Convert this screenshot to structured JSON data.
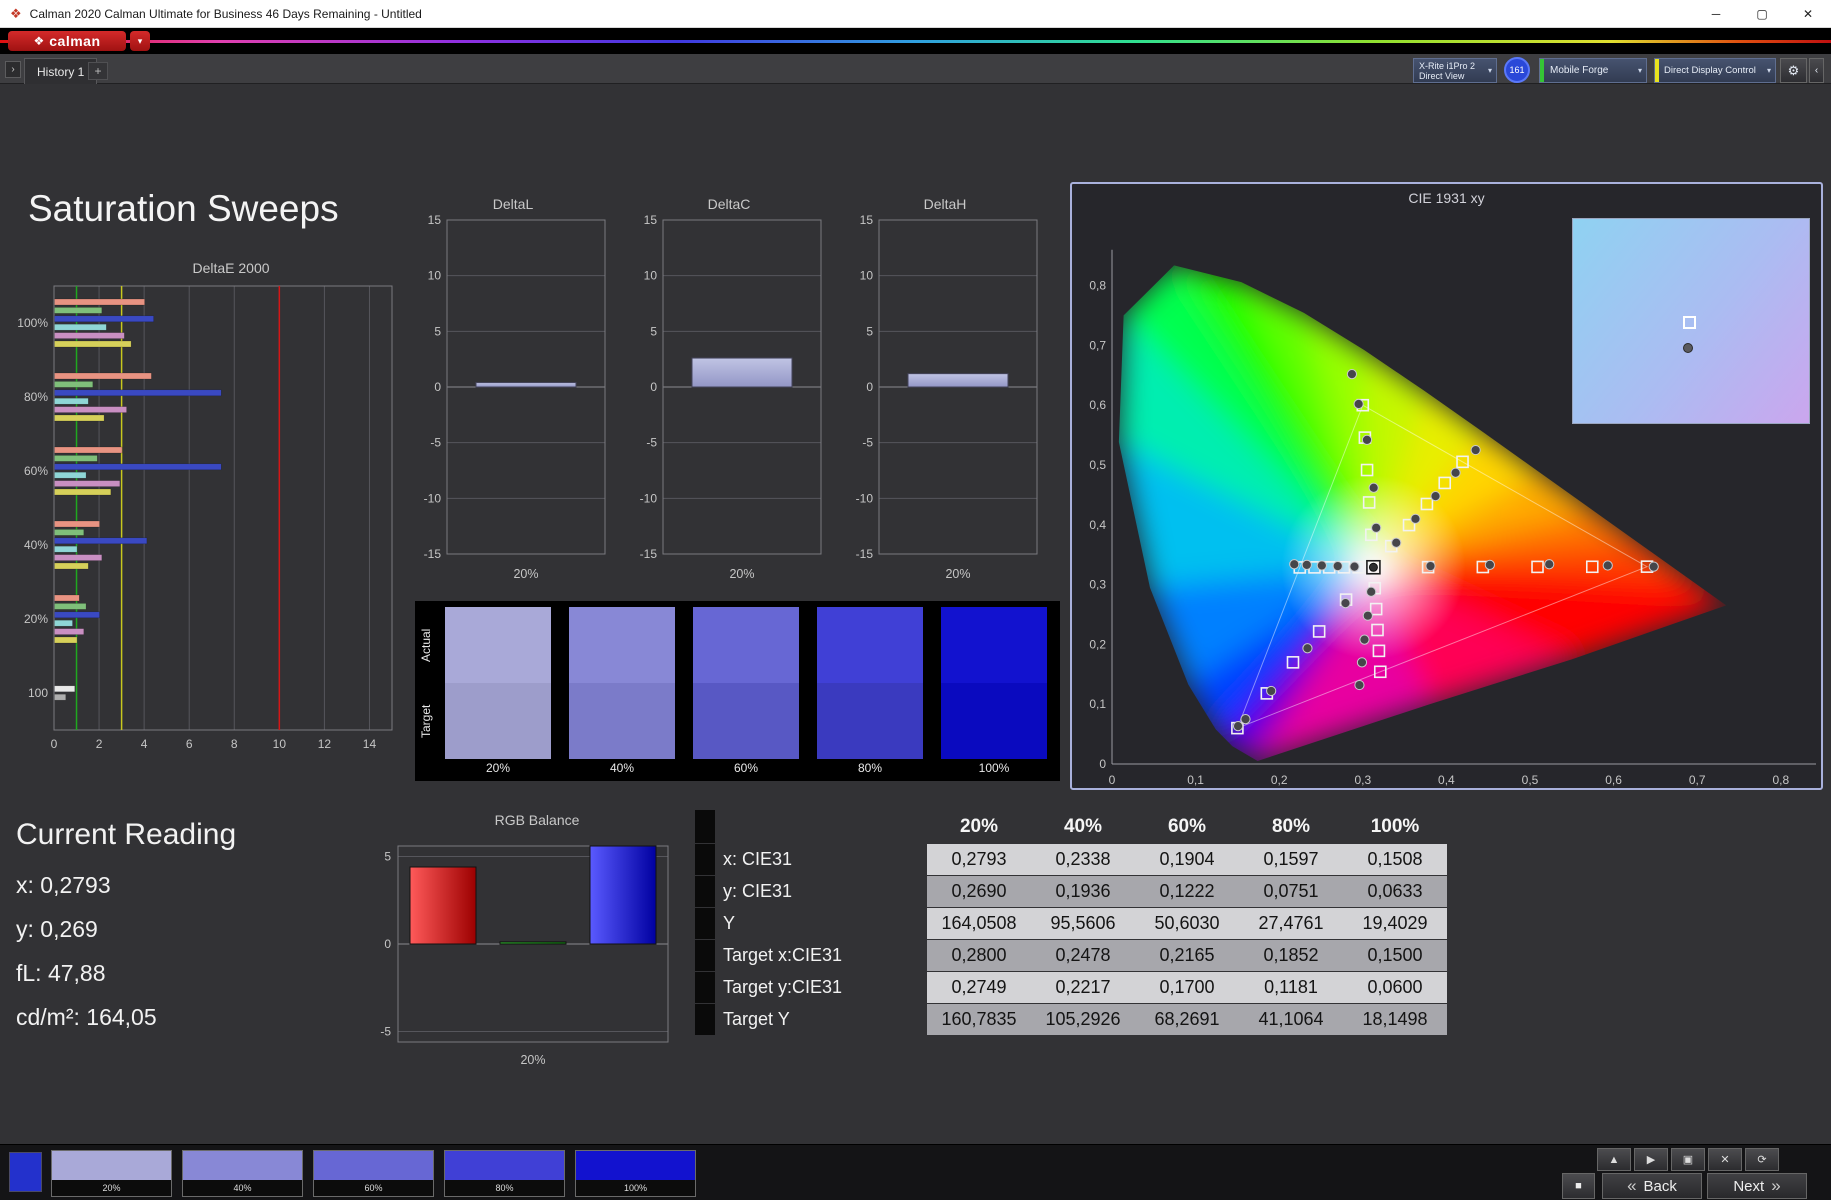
{
  "window": {
    "title": "Calman 2020 Calman Ultimate for Business 46 Days Remaining - Untitled"
  },
  "icons": {
    "app": "❖",
    "logo_mark": "❖",
    "dropdown": "▾",
    "gear": "⚙",
    "collapse": "‹",
    "panel_arrow": "›",
    "minimize": "─",
    "maximize": "▢",
    "close": "✕",
    "stop": "■",
    "back_chevrons": "«",
    "next_chevrons": "»"
  },
  "brand": {
    "logo_text": "calman"
  },
  "tabbar": {
    "history_tab": "History 1",
    "add_tab": "+",
    "meter_line1": "X-Rite i1Pro 2",
    "meter_line2": "Direct View",
    "badge": "161",
    "source_label": "Mobile Forge",
    "display_label": "Direct Display Control"
  },
  "toolbar_colors": {
    "source_stripe": "#35c435",
    "display_stripe": "#e8e21e"
  },
  "page": {
    "title": "Saturation Sweeps"
  },
  "current_reading": {
    "title": "Current Reading",
    "lines": [
      "x: 0,2793",
      "y: 0,269",
      "fL: 47,88",
      "cd/m²: 164,05"
    ]
  },
  "chart_data": {
    "deltae2000": {
      "type": "bar",
      "title": "DeltaE 2000",
      "orientation": "horizontal",
      "xlim": [
        0,
        15
      ],
      "xticks": [
        0,
        2,
        4,
        6,
        8,
        10,
        12,
        14
      ],
      "limit_lines": [
        {
          "value": 1,
          "color": "#1fa81f"
        },
        {
          "value": 3,
          "color": "#c8c81e"
        },
        {
          "value": 10,
          "color": "#d41616"
        }
      ],
      "groups": [
        {
          "label": "100%",
          "values": [
            4.0,
            2.1,
            4.4,
            2.3,
            3.1,
            3.4
          ],
          "colors": [
            "#e89382",
            "#7fbf7a",
            "#3a49c2",
            "#8fd6d6",
            "#c98fc2",
            "#d6d05a"
          ]
        },
        {
          "label": "80%",
          "values": [
            4.3,
            1.7,
            7.4,
            1.5,
            3.2,
            2.2
          ],
          "colors": [
            "#e89382",
            "#7fbf7a",
            "#3a49c2",
            "#8fd6d6",
            "#c98fc2",
            "#d6d05a"
          ]
        },
        {
          "label": "60%",
          "values": [
            3.0,
            1.9,
            7.4,
            1.4,
            2.9,
            2.5
          ],
          "colors": [
            "#e89382",
            "#7fbf7a",
            "#3a49c2",
            "#8fd6d6",
            "#c98fc2",
            "#d6d05a"
          ]
        },
        {
          "label": "40%",
          "values": [
            2.0,
            1.3,
            4.1,
            1.0,
            2.1,
            1.5
          ],
          "colors": [
            "#e89382",
            "#7fbf7a",
            "#3a49c2",
            "#8fd6d6",
            "#c98fc2",
            "#d6d05a"
          ]
        },
        {
          "label": "20%",
          "values": [
            1.1,
            1.4,
            2.0,
            0.8,
            1.3,
            1.0
          ],
          "colors": [
            "#e89382",
            "#7fbf7a",
            "#3a49c2",
            "#8fd6d6",
            "#c98fc2",
            "#d6d05a"
          ]
        },
        {
          "label": "100",
          "values": [
            0.9,
            0.5
          ],
          "colors": [
            "#e8e8e8",
            "#aeaeae"
          ]
        }
      ]
    },
    "deltaL": {
      "type": "bar",
      "title": "DeltaL",
      "value": 0.4,
      "ymax": 15,
      "yticks": [
        15,
        10,
        5,
        0,
        -5,
        -10,
        -15
      ],
      "xlabel": "20%"
    },
    "deltaC": {
      "type": "bar",
      "title": "DeltaC",
      "value": 2.6,
      "ymax": 15,
      "yticks": [
        15,
        10,
        5,
        0,
        -5,
        -10,
        -15
      ],
      "xlabel": "20%"
    },
    "deltaH": {
      "type": "bar",
      "title": "DeltaH",
      "value": 1.2,
      "ymax": 15,
      "yticks": [
        15,
        10,
        5,
        0,
        -5,
        -10,
        -15
      ],
      "xlabel": "20%"
    },
    "rgb_balance": {
      "type": "bar",
      "title": "RGB Balance",
      "ymax": 5.6,
      "yticks": [
        5,
        0,
        -5
      ],
      "xlabel": "20%",
      "series": [
        {
          "name": "red",
          "value": 4.4,
          "color_light": "#ff5a5a",
          "color_dark": "#9c0000"
        },
        {
          "name": "green",
          "value": 0.12,
          "color_light": "#2fae2f",
          "color_dark": "#0f7a0f"
        },
        {
          "name": "blue",
          "value": 5.9,
          "color_light": "#5a5aff",
          "color_dark": "#0000a0"
        }
      ]
    },
    "cie1931": {
      "type": "scatter",
      "title": "CIE 1931 xy",
      "xticks": [
        "0",
        "0,1",
        "0,2",
        "0,3",
        "0,4",
        "0,5",
        "0,6",
        "0,7",
        "0,8"
      ],
      "yticks": [
        "0",
        "0,1",
        "0,2",
        "0,3",
        "0,4",
        "0,5",
        "0,6",
        "0,7",
        "0,8"
      ],
      "white_point": [
        0.3127,
        0.329
      ],
      "gamut_triangle": [
        [
          0.64,
          0.33
        ],
        [
          0.3,
          0.6
        ],
        [
          0.15,
          0.06
        ]
      ],
      "locus": [
        [
          0.1741,
          0.005,
          "#7a00c8"
        ],
        [
          0.144,
          0.0297,
          "#3300ff"
        ],
        [
          0.1241,
          0.0578,
          "#0040ff"
        ],
        [
          0.0913,
          0.1327,
          "#0080ff"
        ],
        [
          0.0454,
          0.295,
          "#00c0f0"
        ],
        [
          0.0082,
          0.5384,
          "#00eeb0"
        ],
        [
          0.0139,
          0.7502,
          "#00ff50"
        ],
        [
          0.0743,
          0.8338,
          "#20ff00"
        ],
        [
          0.1547,
          0.8059,
          "#60ff00"
        ],
        [
          0.2296,
          0.7543,
          "#98ff00"
        ],
        [
          0.3016,
          0.6923,
          "#c4f800"
        ],
        [
          0.3731,
          0.6245,
          "#e8ee00"
        ],
        [
          0.4441,
          0.5547,
          "#ffd500"
        ],
        [
          0.5125,
          0.4866,
          "#ffaa00"
        ],
        [
          0.5752,
          0.4242,
          "#ff7700"
        ],
        [
          0.627,
          0.3725,
          "#ff4400"
        ],
        [
          0.6915,
          0.3083,
          "#ff1100"
        ],
        [
          0.7347,
          0.2653,
          "#ff0000"
        ],
        [
          0.55,
          0.175,
          "#ff0055"
        ],
        [
          0.38,
          0.1,
          "#e800a0"
        ]
      ],
      "targets": [
        [
          0.28,
          0.2749
        ],
        [
          0.2478,
          0.2217
        ],
        [
          0.2165,
          0.17
        ],
        [
          0.1852,
          0.1181
        ],
        [
          0.15,
          0.06
        ],
        [
          0.3781,
          0.3292
        ],
        [
          0.4436,
          0.3294
        ],
        [
          0.509,
          0.3296
        ],
        [
          0.5745,
          0.3298
        ],
        [
          0.64,
          0.33
        ],
        [
          0.3102,
          0.3832
        ],
        [
          0.3076,
          0.4374
        ],
        [
          0.3051,
          0.4916
        ],
        [
          0.3025,
          0.5458
        ],
        [
          0.3,
          0.6
        ],
        [
          0.2951,
          0.3289
        ],
        [
          0.2775,
          0.3289
        ],
        [
          0.2598,
          0.3288
        ],
        [
          0.2422,
          0.3288
        ],
        [
          0.2246,
          0.3287
        ],
        [
          0.3143,
          0.294
        ],
        [
          0.316,
          0.2591
        ],
        [
          0.3176,
          0.2241
        ],
        [
          0.3193,
          0.1892
        ],
        [
          0.3209,
          0.1542
        ],
        [
          0.334,
          0.3643
        ],
        [
          0.3553,
          0.3995
        ],
        [
          0.3767,
          0.4348
        ],
        [
          0.398,
          0.47
        ],
        [
          0.4193,
          0.5053
        ]
      ],
      "measured": [
        [
          0.2793,
          0.269
        ],
        [
          0.2338,
          0.1936
        ],
        [
          0.1904,
          0.1222
        ],
        [
          0.1597,
          0.0751
        ],
        [
          0.1508,
          0.0633
        ],
        [
          0.381,
          0.331
        ],
        [
          0.452,
          0.333
        ],
        [
          0.523,
          0.334
        ],
        [
          0.593,
          0.332
        ],
        [
          0.648,
          0.33
        ],
        [
          0.316,
          0.395
        ],
        [
          0.313,
          0.462
        ],
        [
          0.305,
          0.542
        ],
        [
          0.295,
          0.602
        ],
        [
          0.287,
          0.652
        ],
        [
          0.29,
          0.33
        ],
        [
          0.27,
          0.331
        ],
        [
          0.251,
          0.332
        ],
        [
          0.233,
          0.333
        ],
        [
          0.218,
          0.334
        ],
        [
          0.31,
          0.288
        ],
        [
          0.306,
          0.248
        ],
        [
          0.302,
          0.208
        ],
        [
          0.299,
          0.17
        ],
        [
          0.296,
          0.132
        ],
        [
          0.34,
          0.37
        ],
        [
          0.363,
          0.41
        ],
        [
          0.387,
          0.448
        ],
        [
          0.411,
          0.487
        ],
        [
          0.435,
          0.525
        ]
      ],
      "inset_gradient": [
        "#8fd2f2",
        "#abbcf2",
        "#cba6ee"
      ]
    }
  },
  "swatch_strip": {
    "row_labels": [
      "Actual",
      "Target"
    ],
    "columns": [
      "20%",
      "40%",
      "60%",
      "80%",
      "100%"
    ],
    "actual_colors": [
      "#a9a9d8",
      "#8888d6",
      "#6767d4",
      "#4040d6",
      "#1212cf"
    ],
    "target_colors": [
      "#9d9dcb",
      "#7b7bc9",
      "#5858c4",
      "#3a3abf",
      "#0a0abf"
    ]
  },
  "table": {
    "columns": [
      "20%",
      "40%",
      "60%",
      "80%",
      "100%"
    ],
    "rows": [
      {
        "label": "x: CIE31",
        "values": [
          "0,2793",
          "0,2338",
          "0,1904",
          "0,1597",
          "0,1508"
        ]
      },
      {
        "label": "y: CIE31",
        "values": [
          "0,2690",
          "0,1936",
          "0,1222",
          "0,0751",
          "0,0633"
        ]
      },
      {
        "label": "Y",
        "values": [
          "164,0508",
          "95,5606",
          "50,6030",
          "27,4761",
          "19,4029"
        ]
      },
      {
        "label": "Target x:CIE31",
        "values": [
          "0,2800",
          "0,2478",
          "0,2165",
          "0,1852",
          "0,1500"
        ]
      },
      {
        "label": "Target y:CIE31",
        "values": [
          "0,2749",
          "0,2217",
          "0,1700",
          "0,1181",
          "0,0600"
        ]
      },
      {
        "label": "Target Y",
        "values": [
          "160,7835",
          "105,2926",
          "68,2691",
          "41,1064",
          "18,1498"
        ]
      }
    ]
  },
  "bottombar": {
    "pattern_color": "#2331cc",
    "swatches": [
      {
        "label": "20%",
        "color": "#a9a9d8"
      },
      {
        "label": "40%",
        "color": "#8888d6"
      },
      {
        "label": "60%",
        "color": "#6767d4"
      },
      {
        "label": "80%",
        "color": "#4040d6"
      },
      {
        "label": "100%",
        "color": "#1212cf"
      }
    ],
    "transport": [
      {
        "name": "up",
        "glyph": "▲"
      },
      {
        "name": "play",
        "glyph": "▶"
      },
      {
        "name": "display",
        "glyph": "▣"
      },
      {
        "name": "close",
        "glyph": "✕"
      },
      {
        "name": "refresh",
        "glyph": "⟳"
      }
    ],
    "back_label": "Back",
    "next_label": "Next"
  }
}
